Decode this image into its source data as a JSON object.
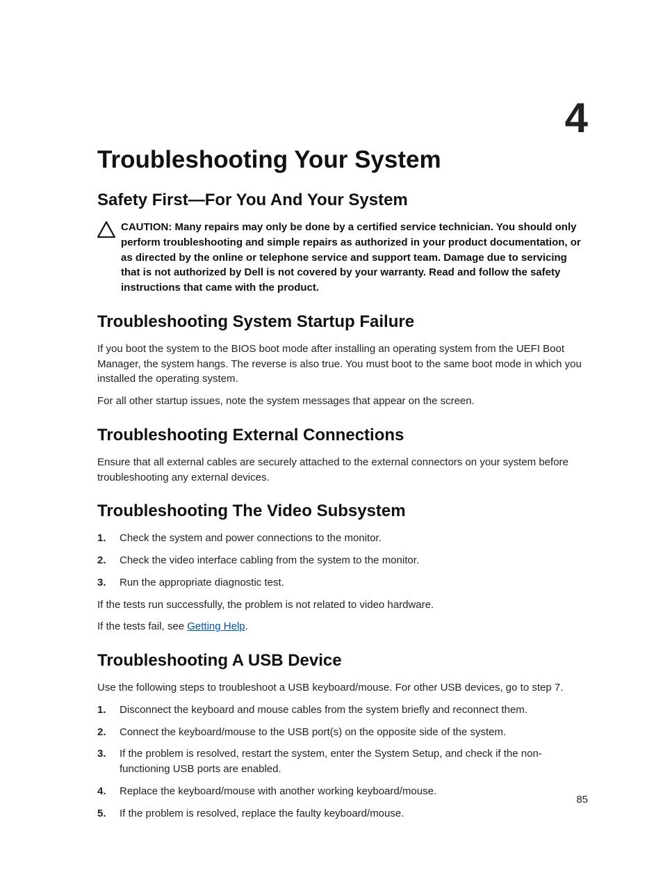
{
  "chapterNumber": "4",
  "title": "Troubleshooting Your System",
  "pageNumber": "85",
  "sections": {
    "safety": {
      "heading": "Safety First—For You And Your System",
      "cautionLabel": "CAUTION: ",
      "cautionText": "Many repairs may only be done by a certified service technician. You should only perform troubleshooting and simple repairs as authorized in your product documentation, or as directed by the online or telephone service and support team. Damage due to servicing that is not authorized by Dell is not covered by your warranty. Read and follow the safety instructions that came with the product."
    },
    "startup": {
      "heading": "Troubleshooting System Startup Failure",
      "para1": "If you boot the system to the BIOS boot mode after installing an operating system from the UEFI Boot Manager, the system hangs. The reverse is also true. You must boot to the same boot mode in which you installed the operating system.",
      "para2": "For all other startup issues, note the system messages that appear on the screen."
    },
    "external": {
      "heading": "Troubleshooting External Connections",
      "para1": "Ensure that all external cables are securely attached to the external connectors on your system before troubleshooting any external devices."
    },
    "video": {
      "heading": "Troubleshooting The Video Subsystem",
      "steps": [
        "Check the system and power connections to the monitor.",
        "Check the video interface cabling from the system to the monitor.",
        "Run the appropriate diagnostic test."
      ],
      "afterSuccess": "If the tests run successfully, the problem is not related to video hardware.",
      "afterFailPrefix": "If the tests fail, see ",
      "afterFailLink": "Getting Help",
      "afterFailSuffix": "."
    },
    "usb": {
      "heading": "Troubleshooting A USB Device",
      "intro": "Use the following steps to troubleshoot a USB keyboard/mouse. For other USB devices, go to step 7.",
      "steps": [
        "Disconnect the keyboard and mouse cables from the system briefly and reconnect them.",
        "Connect the keyboard/mouse to the USB port(s) on the opposite side of the system.",
        "If the problem is resolved, restart the system, enter the System Setup, and check if the non-functioning USB ports are enabled.",
        "Replace the keyboard/mouse with another working keyboard/mouse.",
        "If the problem is resolved, replace the faulty keyboard/mouse."
      ]
    }
  }
}
